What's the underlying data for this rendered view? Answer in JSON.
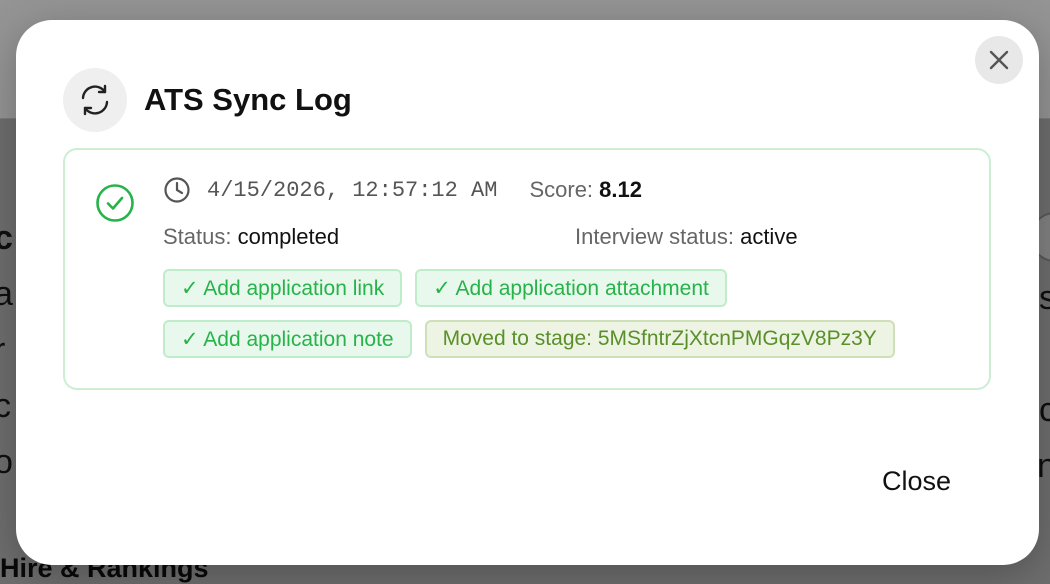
{
  "background": {
    "left_glyphs": [
      "c",
      "a",
      "r",
      "c",
      "o"
    ],
    "right_glyphs": [
      "s",
      "",
      "c",
      "n"
    ],
    "footer_text": "Hire & Rankings"
  },
  "modal": {
    "title": "ATS Sync Log",
    "header_icon": "refresh-icon",
    "close_icon": "close-icon",
    "entry": {
      "timestamp": "4/15/2026, 12:57:12 AM",
      "score_label": "Score:",
      "score_value": "8.12",
      "status_label": "Status:",
      "status_value": "completed",
      "interview_label": "Interview status:",
      "interview_value": "active",
      "chips_row1": [
        "✓ Add application link",
        "✓ Add application attachment"
      ],
      "chips_row2": [
        "✓ Add application note",
        "Moved to stage: 5MSfntrZjXtcnPMGqzV8Pz3Y"
      ]
    },
    "close_label": "Close"
  },
  "colors": {
    "success": "#26b34a",
    "stage": "#5a8f2a",
    "card_border": "#cdeed3"
  }
}
